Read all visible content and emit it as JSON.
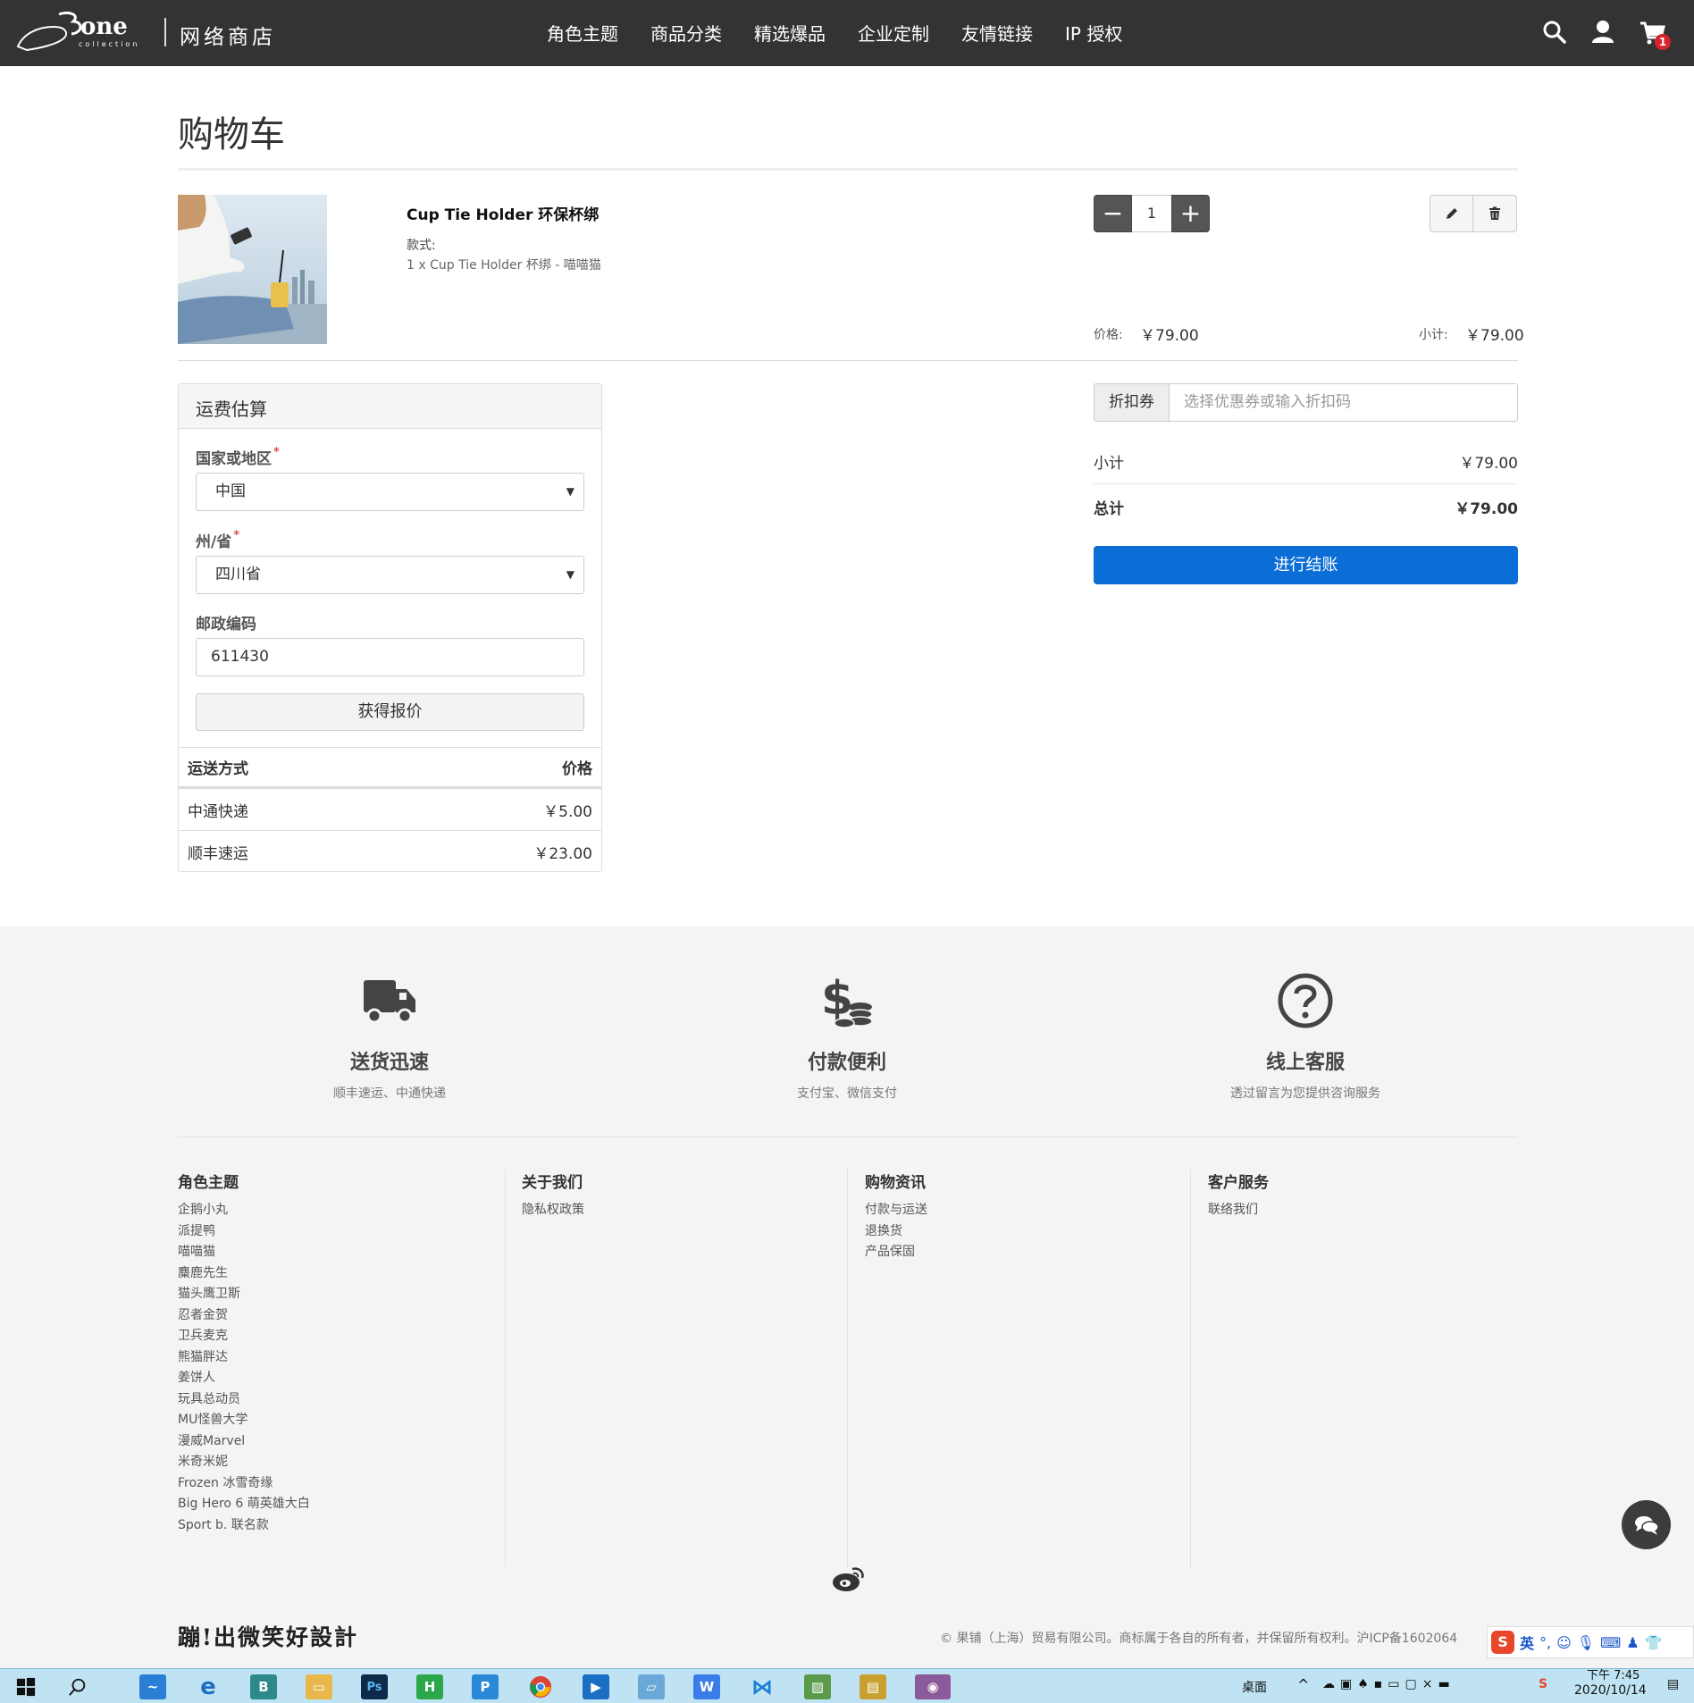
{
  "header": {
    "store_name": "网络商店",
    "nav": [
      "角色主题",
      "商品分类",
      "精选爆品",
      "企业定制",
      "友情链接",
      "IP 授权"
    ],
    "cart_count": "1",
    "colors": {
      "bar": "#333333",
      "badge": "#d9232d"
    }
  },
  "cart": {
    "title": "购物车",
    "item": {
      "name": "Cup Tie Holder 环保杯绑",
      "option_label": "款式:",
      "option_value": "1 x Cup Tie Holder 杯绑 - 喵喵猫",
      "quantity": "1",
      "price_label": "价格:",
      "price": "￥79.00",
      "subtotal_label": "小计:",
      "subtotal": "￥79.00"
    }
  },
  "shipping": {
    "title": "运费估算",
    "country_label": "国家或地区",
    "country_value": "中国",
    "state_label": "州/省",
    "state_value": "四川省",
    "zip_label": "邮政编码",
    "zip_value": "611430",
    "quote_button": "获得报价",
    "table_headers": [
      "运送方式",
      "价格"
    ],
    "methods": [
      {
        "name": "中通快递",
        "price": "￥5.00"
      },
      {
        "name": "顺丰速运",
        "price": "￥23.00"
      }
    ]
  },
  "summary": {
    "coupon_label": "折扣券",
    "coupon_placeholder": "选择优惠券或输入折扣码",
    "subtotal_label": "小计",
    "subtotal": "￥79.00",
    "total_label": "总计",
    "total": "￥79.00",
    "checkout_button": "进行结账",
    "checkout_color": "#0a6ed6"
  },
  "footer": {
    "features": [
      {
        "icon": "truck-icon",
        "title": "送货迅速",
        "subtitle": "顺丰速运、中通快递"
      },
      {
        "icon": "money-icon",
        "title": "付款便利",
        "subtitle": "支付宝、微信支付"
      },
      {
        "icon": "question-icon",
        "title": "线上客服",
        "subtitle": "透过留言为您提供咨询服务"
      }
    ],
    "columns": [
      {
        "title": "角色主题",
        "links": [
          "企鹅小丸",
          "派提鸭",
          "喵喵猫",
          "麋鹿先生",
          "猫头鹰卫斯",
          "忍者金贺",
          "卫兵麦克",
          "熊猫胖达",
          "姜饼人",
          "玩具总动员",
          "MU怪兽大学",
          "漫威Marvel",
          "米奇米妮",
          "Frozen 冰雪奇缘",
          "Big Hero 6 萌英雄大白",
          "Sport b. 联名款"
        ]
      },
      {
        "title": "关于我们",
        "links": [
          "隐私权政策"
        ]
      },
      {
        "title": "购物资讯",
        "links": [
          "付款与运送",
          "退换货",
          "产品保固"
        ]
      },
      {
        "title": "客户服务",
        "links": [
          "联络我们"
        ]
      }
    ],
    "signature": "蹦!出微笑好設計",
    "copyright": "© 果铺（上海）贸易有限公司。商标属于各自的所有者，并保留所有权利。沪ICP备1602064"
  },
  "ime": {
    "mode": "英"
  },
  "taskbar": {
    "desktop_label": "桌面",
    "time": "下午 7:45",
    "date": "2020/10/14"
  }
}
